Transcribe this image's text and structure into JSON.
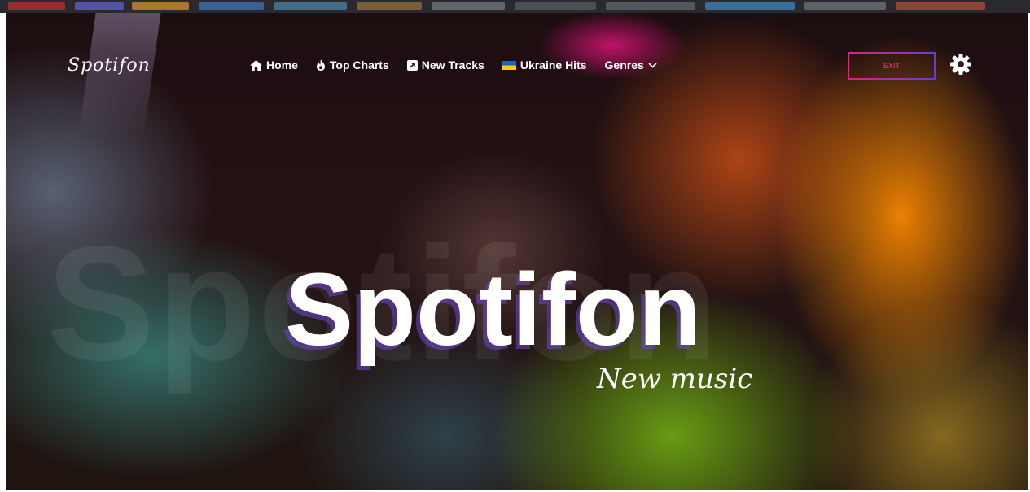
{
  "brand": {
    "logo_text": "Spotifon"
  },
  "nav": {
    "items": [
      {
        "label": "Home",
        "icon": "home-icon"
      },
      {
        "label": "Top Charts",
        "icon": "fire-icon"
      },
      {
        "label": "New Tracks",
        "icon": "external-link-icon"
      },
      {
        "label": "Ukraine Hits",
        "icon": "ukraine-flag-icon"
      },
      {
        "label": "Genres",
        "icon": "chevron-down-icon"
      }
    ]
  },
  "header": {
    "exit_label": "EXIT",
    "settings_icon": "gear-icon"
  },
  "hero": {
    "title": "Spotifon",
    "subtitle": "New music",
    "watermark": "Spotifon"
  },
  "colors": {
    "exit_border_start": "#d9287a",
    "exit_border_end": "#6a3bd6",
    "exit_text": "#ff3b8b",
    "title_shadow": "#6e46d2",
    "ukraine_blue": "#1e5ec9",
    "ukraine_yellow": "#f5cf00"
  }
}
